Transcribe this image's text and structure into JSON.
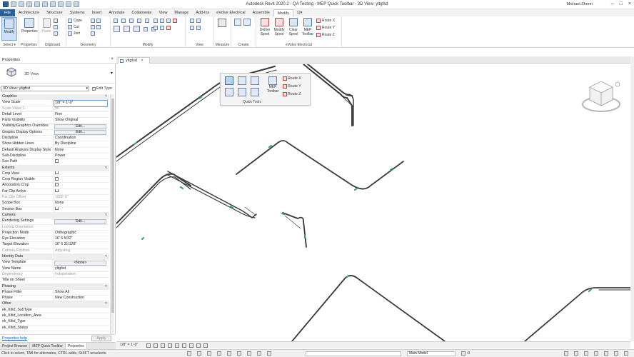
{
  "window": {
    "title": "Autodesk Revit 2020.2 - QA Testing - MEP Quick Toolbar - 3D View: yltgfsd",
    "user": "Michael.Shenn"
  },
  "ribbon_tabs": [
    "File",
    "Architecture",
    "Structure",
    "Systems",
    "Insert",
    "Annotate",
    "Collaborate",
    "View",
    "Manage",
    "Add-Ins",
    "eVolve Electrical",
    "Assemble",
    "Modify",
    "⊡▾"
  ],
  "ribbon": {
    "select": {
      "modify": "Modify",
      "label": "Select ▾"
    },
    "properties": {
      "btn": "Properties",
      "label": "Properties"
    },
    "clipboard": {
      "paste": "Paste",
      "label": "Clipboard"
    },
    "geometry": {
      "cope": "Cope",
      "cut": "Cut",
      "join": "Join",
      "label": "Geometry"
    },
    "modify": {
      "label": "Modify"
    },
    "view": {
      "label": "View"
    },
    "measure": {
      "label": "Measure"
    },
    "create": {
      "label": "Create"
    },
    "evolve": {
      "define_spool": "Define Spool",
      "modify_spool": "Modify Spool",
      "clear_spool": "Clear Spool",
      "mep_toolbar": "MEP Toolbar",
      "route_x": "Route X",
      "route_y": "Route Y",
      "route_z": "Route Z",
      "label": "eVolve Electrical"
    }
  },
  "properties": {
    "header": "Properties",
    "close": "×",
    "type_name": "3D View",
    "instance_selector": "3D View: yltgfsd",
    "edit_type": "Edit Type",
    "help_link": "Properties help",
    "apply": "Apply",
    "rows": [
      {
        "kind": "cat",
        "label": "Graphics"
      },
      {
        "kind": "val",
        "label": "View Scale",
        "value": "1/8\" = 1'-0\"",
        "sel": true
      },
      {
        "kind": "val",
        "label": "Scale Value    1:",
        "value": "96",
        "dim": true
      },
      {
        "kind": "val",
        "label": "Detail Level",
        "value": "Fine"
      },
      {
        "kind": "val",
        "label": "Parts Visibility",
        "value": "Show Original"
      },
      {
        "kind": "btn",
        "label": "Visibility/Graphics Overrides",
        "value": "Edit..."
      },
      {
        "kind": "btn",
        "label": "Graphic Display Options",
        "value": "Edit..."
      },
      {
        "kind": "val",
        "label": "Discipline",
        "value": "Coordination"
      },
      {
        "kind": "val",
        "label": "Show Hidden Lines",
        "value": "By Discipline"
      },
      {
        "kind": "val",
        "label": "Default Analysis Display Style",
        "value": "None"
      },
      {
        "kind": "val",
        "label": "Sub-Discipline",
        "value": "Power"
      },
      {
        "kind": "chk",
        "label": "Sun Path"
      },
      {
        "kind": "cat",
        "label": "Extents"
      },
      {
        "kind": "chk",
        "label": "Crop View"
      },
      {
        "kind": "chk",
        "label": "Crop Region Visible"
      },
      {
        "kind": "chk",
        "label": "Annotation Crop"
      },
      {
        "kind": "chk",
        "label": "Far Clip Active"
      },
      {
        "kind": "val",
        "label": "Far Clip Offset",
        "value": "1000' 0\"",
        "dim": true
      },
      {
        "kind": "val",
        "label": "Scope Box",
        "value": "None"
      },
      {
        "kind": "chk",
        "label": "Section Box"
      },
      {
        "kind": "cat",
        "label": "Camera"
      },
      {
        "kind": "btn",
        "label": "Rendering Settings",
        "value": "Edit..."
      },
      {
        "kind": "val",
        "label": "Locked Orientation",
        "value": "",
        "dim": true
      },
      {
        "kind": "val",
        "label": "Projection Mode",
        "value": "Orthographic"
      },
      {
        "kind": "val",
        "label": "Eye Elevation",
        "value": "16' 6 5/32\""
      },
      {
        "kind": "val",
        "label": "Target Elevation",
        "value": "16' 6 31/128\""
      },
      {
        "kind": "val",
        "label": "Camera Position",
        "value": "Adjusting",
        "dim": true
      },
      {
        "kind": "cat",
        "label": "Identity Data"
      },
      {
        "kind": "btn",
        "label": "View Template",
        "value": "<None>"
      },
      {
        "kind": "val",
        "label": "View Name",
        "value": "yltgfsd"
      },
      {
        "kind": "val",
        "label": "Dependency",
        "value": "Independent",
        "dim": true
      },
      {
        "kind": "val",
        "label": "Title on Sheet",
        "value": ""
      },
      {
        "kind": "cat",
        "label": "Phasing"
      },
      {
        "kind": "val",
        "label": "Phase Filter",
        "value": "Show All"
      },
      {
        "kind": "val",
        "label": "Phase",
        "value": "New Construction"
      },
      {
        "kind": "cat",
        "label": "Other"
      },
      {
        "kind": "val",
        "label": "ek_Kitid_SubType",
        "value": ""
      },
      {
        "kind": "val",
        "label": "ek_Kitid_Location_Area",
        "value": ""
      },
      {
        "kind": "val",
        "label": "ek_Kitid_Type",
        "value": ""
      },
      {
        "kind": "val",
        "label": "ek_Kitid_Status",
        "value": ""
      }
    ]
  },
  "panel_tabs": [
    "Project Browser",
    "MEP Quick Toolbar",
    "Properties"
  ],
  "view": {
    "tab_name": "yltgfsd",
    "tab_close": "×",
    "scale": "1/8\" = 1'-0\""
  },
  "quick_tools": {
    "label": "Quick Tools",
    "mep_toolbar": "MEP Toolbar",
    "route_x": "Route X",
    "route_y": "Route Y",
    "route_z": "Route Z"
  },
  "status": {
    "text": "Click to select, TAB for alternates, CTRL adds, SHIFT unselects.",
    "model": "Main Model",
    "filter_count": ":0"
  },
  "colors": {
    "accent": "#2c5e9e",
    "conduit": "#3a3a3a",
    "fitting": "#3aa08a"
  }
}
